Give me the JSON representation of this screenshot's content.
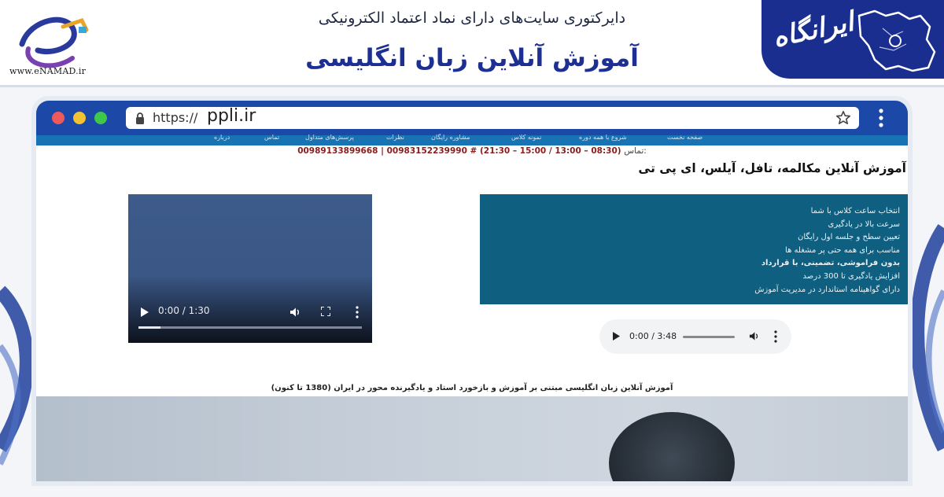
{
  "banner": {
    "subtitle": "دایرکتوری سایت‌های دارای نماد اعتماد الکترونیکی",
    "title": "آموزش آنلاین زبان انگلیسی",
    "enamad_url": "www.eNAMAD.ir",
    "brand_name": "ایرانگاه",
    "brand_color": "#1a2e8f",
    "title_color": "#1e2f93"
  },
  "browser": {
    "url_prefix": "https://",
    "url_domain": "ppli.ir",
    "titlebar_color": "#1c48a8"
  },
  "site": {
    "nav_items": [
      "صفحه نخست",
      "شروع با همه دوره",
      "نمونه کلاس",
      "مشاوره رایگان",
      "نظرات",
      "پرسش‌های متداول",
      "تماس",
      "درباره"
    ],
    "contact_label": "تماس:",
    "contact_numbers": "00989133899668 | 00983152239990 # (21:30 – 15:00 / 13:00 – 08:30)",
    "heading": "آموزش آنلاین مکالمه، تافل، آیلس، ای پی تی",
    "features": [
      {
        "text": "انتخاب ساعت کلاس با شما",
        "bold": false
      },
      {
        "text": "سرعت بالا در یادگیری",
        "bold": false
      },
      {
        "text": "تعیین سطح و جلسه اول رایگان",
        "bold": false
      },
      {
        "text": "مناسب برای همه حتی پر مشغله ها",
        "bold": false
      },
      {
        "text": "بدون فراموشی، تضمینی، با قرارداد",
        "bold": true
      },
      {
        "text": "افزایش یادگیری تا 300 درصد",
        "bold": false
      },
      {
        "text": "دارای گواهینامه استاندارد در مدیریت آموزش",
        "bold": false
      }
    ],
    "features_bg": "#0f5f80",
    "video": {
      "time": "0:00 / 1:30",
      "progress": 0.1
    },
    "audio": {
      "time": "0:00 / 3:48"
    },
    "footer_text": "آموزش آنلاین زبان انگلیسی مبتنی بر آموزش و بازخورد استاد و یادگیرنده محور در ایران (1380 تا کنون)"
  }
}
